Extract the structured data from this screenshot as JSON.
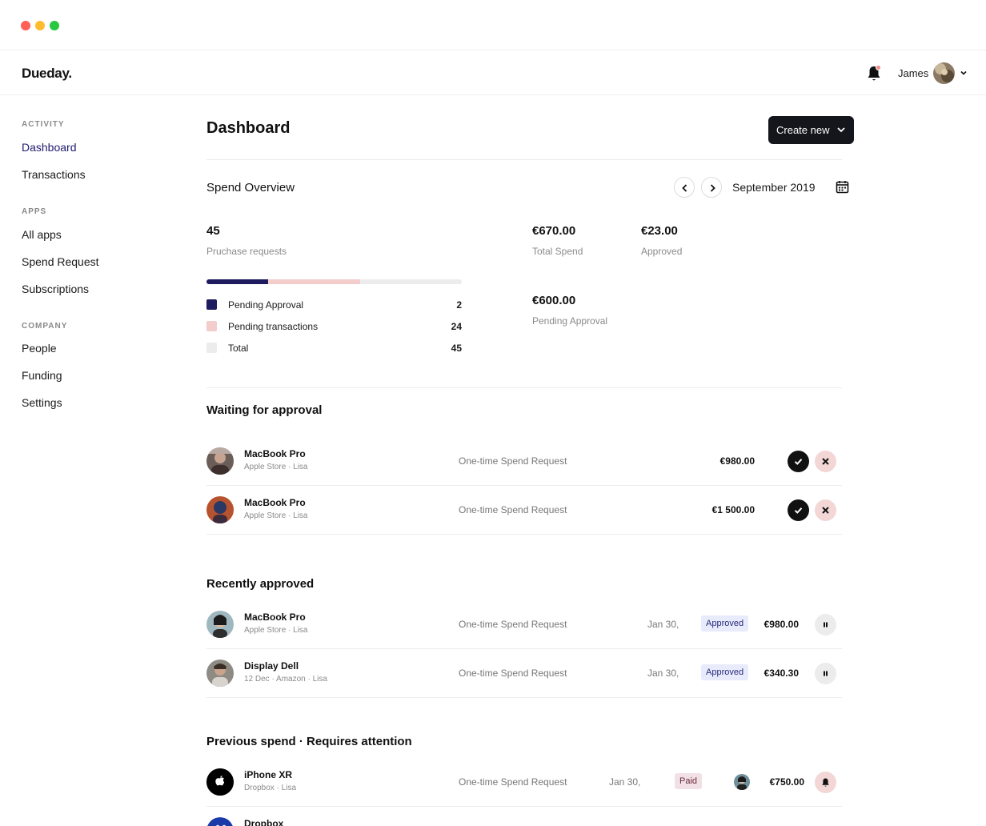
{
  "app": {
    "brand": "Dueday."
  },
  "user": {
    "name": "James"
  },
  "sidebar": {
    "sections": [
      {
        "label": "ACTIVITY",
        "items": [
          {
            "label": "Dashboard",
            "active": true
          },
          {
            "label": "Transactions"
          }
        ]
      },
      {
        "label": "APPS",
        "items": [
          {
            "label": "All apps"
          },
          {
            "label": "Spend Request"
          },
          {
            "label": "Subscriptions"
          }
        ]
      },
      {
        "label": "COMPANY",
        "items": [
          {
            "label": "People"
          },
          {
            "label": "Funding"
          },
          {
            "label": "Settings"
          }
        ]
      }
    ]
  },
  "header": {
    "title": "Dashboard",
    "create_label": "Create new"
  },
  "overview": {
    "title": "Spend Overview",
    "month": "September 2019",
    "purchase_count": "45",
    "purchase_label": "Pruchase requests",
    "total_spend": "€670.00",
    "total_spend_label": "Total Spend",
    "approved": "€23.00",
    "approved_label": "Approved",
    "pending_approval": "€600.00",
    "pending_approval_label": "Pending Approval",
    "progress": {
      "pending_approval": 0.24,
      "pending_transactions": 0.36
    },
    "legend": [
      {
        "label": "Pending Approval",
        "count": "2",
        "color": "#1e1b5e"
      },
      {
        "label": "Pending transactions",
        "count": "24",
        "color": "#f3cccc"
      },
      {
        "label": "Total",
        "count": "45",
        "color": "#ececec"
      }
    ]
  },
  "waiting": {
    "title": "Waiting for approval",
    "rows": [
      {
        "title": "MacBook Pro",
        "sub": "Apple Store · Lisa",
        "type": "One-time Spend Request",
        "amount": "€980.00"
      },
      {
        "title": "MacBook Pro",
        "sub": "Apple Store · Lisa",
        "type": "One-time Spend Request",
        "amount": "€1 500.00"
      }
    ]
  },
  "approved": {
    "title": "Recently approved",
    "rows": [
      {
        "title": "MacBook Pro",
        "sub": "Apple Store · Lisa",
        "type": "One-time Spend Request",
        "date": "Jan 30,",
        "badge": "Approved",
        "amount": "€980.00"
      },
      {
        "title": "Display Dell",
        "sub": "12 Dec · Amazon · Lisa",
        "type": "One-time Spend Request",
        "date": "Jan 30,",
        "badge": "Approved",
        "amount": "€340.30"
      }
    ]
  },
  "previous": {
    "title": "Previous spend · Requires attention",
    "rows": [
      {
        "title": "iPhone XR",
        "sub": "Dropbox · Lisa",
        "type": "One-time Spend Request",
        "date": "Jan 30,",
        "badge": "Paid",
        "amount": "€750.00"
      },
      {
        "title": "Dropbox"
      }
    ]
  },
  "colors": {
    "accent_navy": "#1e1b6e",
    "pink": "#f3d6d6",
    "approved_badge": "#e8ebfb",
    "paid_badge": "#f1e1e6"
  }
}
